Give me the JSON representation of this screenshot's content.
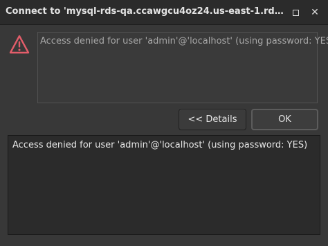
{
  "window": {
    "title": "Connect to 'mysql-rds-qa.ccawgcu4oz24.us-east-1.rds.amazona..."
  },
  "titlebar_icons": {
    "maximize": "maximize-icon",
    "close": "close-icon",
    "close_glyph": "✕"
  },
  "dialog": {
    "icon": "warning-icon",
    "message": "Access denied for user 'admin'@'localhost' (using password: YES)",
    "details_button_label": "<< Details",
    "ok_button_label": "OK",
    "details_text": "Access denied for user 'admin'@'localhost' (using password: YES)"
  },
  "colors": {
    "warning_red": "#e35d6a",
    "background": "#383838",
    "titlebar": "#2b2b2b"
  }
}
